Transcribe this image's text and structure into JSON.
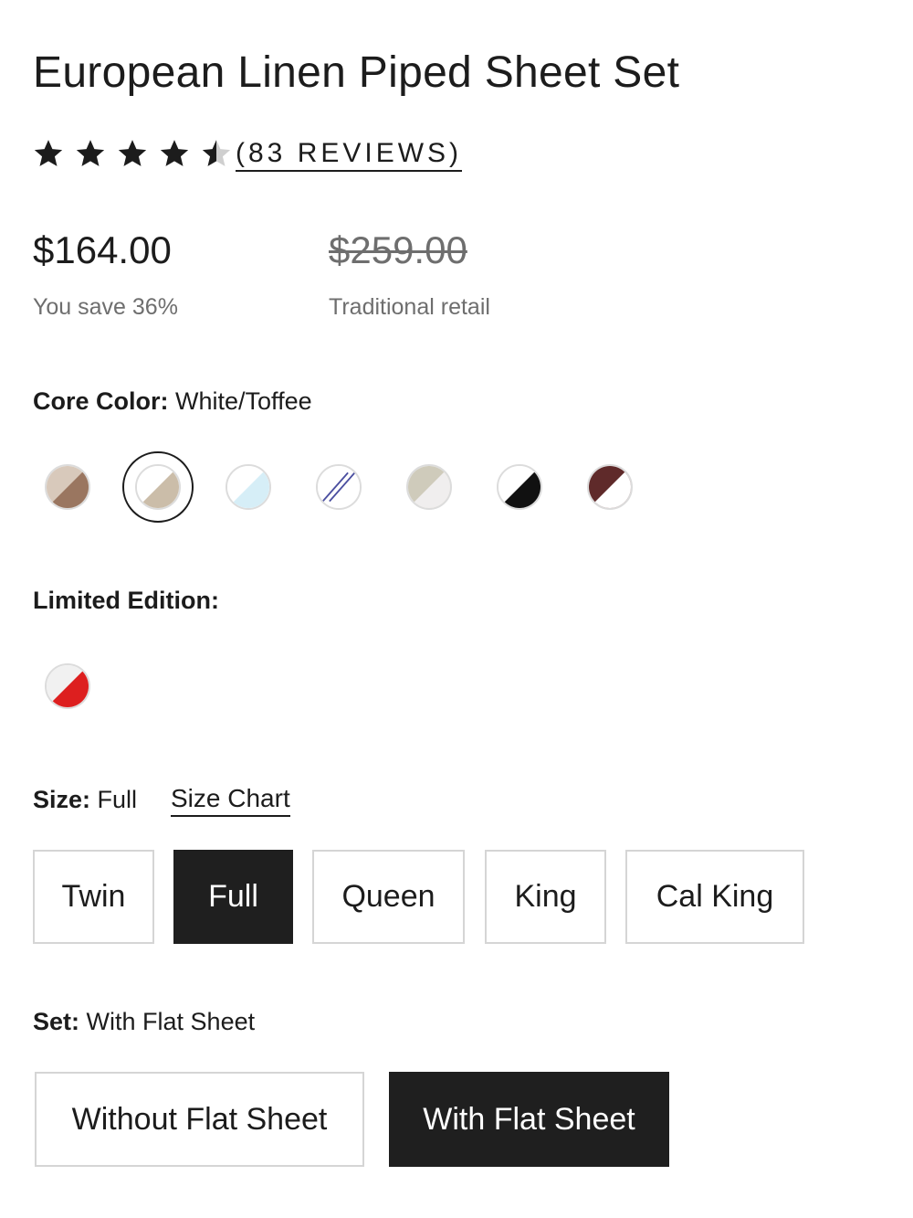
{
  "product": {
    "title": "European Linen Piped Sheet Set",
    "rating": 4.5,
    "rating_max": 5,
    "reviews_label": "(83 REVIEWS)"
  },
  "pricing": {
    "price": "$164.00",
    "savings": "You save 36%",
    "retail_price": "$259.00",
    "retail_label": "Traditional retail"
  },
  "core_color": {
    "label": "Core Color:",
    "selected": "White/Toffee",
    "swatches": [
      {
        "name": "Taupe/Brown",
        "colors": [
          "#d8c9bb",
          "#9a7660"
        ]
      },
      {
        "name": "White/Toffee",
        "colors": [
          "#ffffff",
          "#cbbda9"
        ],
        "selected": true
      },
      {
        "name": "White/Sky",
        "colors": [
          "#ffffff",
          "#d6eef7"
        ]
      },
      {
        "name": "White/Navy Stripe",
        "colors": [
          "#ffffff",
          "#4b4fa0"
        ]
      },
      {
        "name": "Sage/White",
        "colors": [
          "#cfcbbb",
          "#f0eeee"
        ]
      },
      {
        "name": "White/Black",
        "colors": [
          "#ffffff",
          "#111111"
        ]
      },
      {
        "name": "Burgundy/White",
        "colors": [
          "#5f2a2a",
          "#ffffff"
        ]
      }
    ]
  },
  "limited_edition": {
    "label": "Limited Edition:",
    "swatches": [
      {
        "name": "White/Red",
        "colors": [
          "#f1f1f1",
          "#dd1f1f"
        ]
      }
    ]
  },
  "size": {
    "label": "Size:",
    "selected": "Full",
    "chart_link": "Size Chart",
    "options": [
      "Twin",
      "Full",
      "Queen",
      "King",
      "Cal King"
    ]
  },
  "set": {
    "label": "Set:",
    "selected": "With Flat Sheet",
    "options": [
      "Without Flat Sheet",
      "With Flat Sheet"
    ]
  },
  "colors": {
    "text": "#1c1c1c",
    "muted": "#6e6e6e",
    "selected_bg": "#1f1f1f",
    "border": "#d5d5d5",
    "star_empty": "#cfcfcf"
  }
}
